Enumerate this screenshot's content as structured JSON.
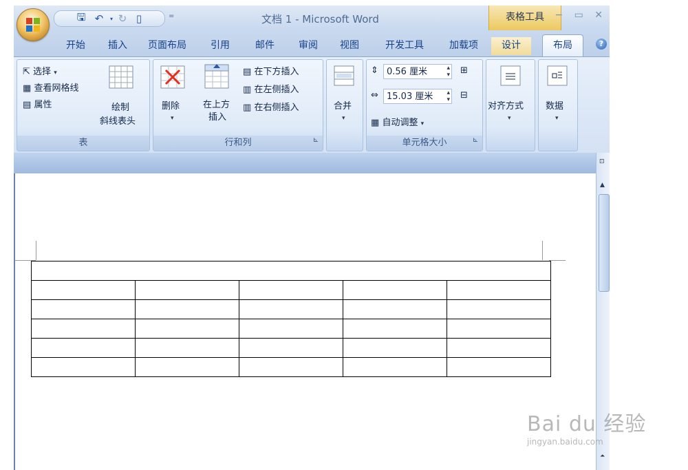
{
  "title_bar": {
    "doc_title": "文档 1 - Microsoft Word",
    "context_title": "表格工具",
    "window_buttons": "− ▭ ✕",
    "qat_sep": "="
  },
  "tabs": [
    {
      "label": "开始"
    },
    {
      "label": "插入"
    },
    {
      "label": "页面布局"
    },
    {
      "label": "引用"
    },
    {
      "label": "邮件"
    },
    {
      "label": "审阅"
    },
    {
      "label": "视图"
    },
    {
      "label": "开发工具"
    },
    {
      "label": "加载项"
    },
    {
      "label": "设计"
    },
    {
      "label": "布局"
    }
  ],
  "ribbon": {
    "table_group": {
      "label": "表",
      "select": "选择",
      "view_gridlines": "查看网格线",
      "properties": "属性",
      "draw_diagonal_1": "绘制",
      "draw_diagonal_2": "斜线表头"
    },
    "rows_cols_group": {
      "label": "行和列",
      "delete": "删除",
      "insert_above_1": "在上方",
      "insert_above_2": "插入",
      "insert_below": "在下方插入",
      "insert_left": "在左侧插入",
      "insert_right": "在右侧插入"
    },
    "merge_group": {
      "label": "合并"
    },
    "cell_size_group": {
      "label": "单元格大小",
      "height_value": "0.56 厘米",
      "width_value": "15.03 厘米",
      "autofit": "自动调整"
    },
    "align": {
      "label": "对齐方式"
    },
    "data": {
      "label": "数据"
    }
  },
  "document": {
    "table": {
      "rows": 6,
      "first_row_merged": true,
      "columns": 5
    }
  },
  "watermark": {
    "brand": "Bai du 经验",
    "url": "jingyan.baidu.com"
  },
  "colors": {
    "ribbon_blue": "#d4e2f4",
    "context_gold": "#ecc95f",
    "tab_text": "#15428b"
  }
}
